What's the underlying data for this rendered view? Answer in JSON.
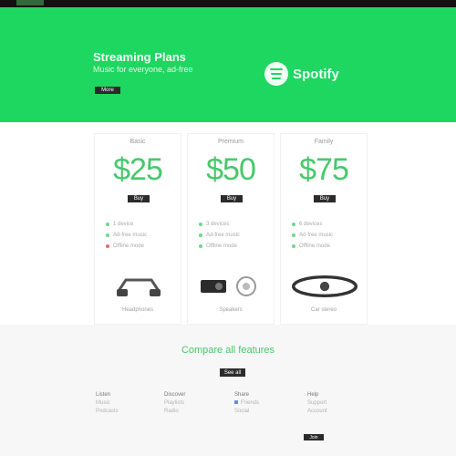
{
  "hero": {
    "title": "Streaming Plans",
    "subtitle": "Music for everyone, ad-free",
    "cta_label": "More",
    "brand_name": "Spotify"
  },
  "plans": [
    {
      "name": "Basic",
      "price": "$25",
      "button_label": "Buy",
      "features": [
        {
          "text": "1 device",
          "status": "included"
        },
        {
          "text": "Ad-free music",
          "status": "included"
        },
        {
          "text": "Offline mode",
          "status": "excluded"
        }
      ],
      "device_label": "Headphones",
      "device_icon": "headphones-icon"
    },
    {
      "name": "Premium",
      "price": "$50",
      "button_label": "Buy",
      "features": [
        {
          "text": "3 devices",
          "status": "included"
        },
        {
          "text": "Ad-free music",
          "status": "included"
        },
        {
          "text": "Offline mode",
          "status": "included"
        }
      ],
      "device_label": "Speakers",
      "device_icon": "speaker-icon"
    },
    {
      "name": "Family",
      "price": "$75",
      "button_label": "Buy",
      "features": [
        {
          "text": "6 devices",
          "status": "included"
        },
        {
          "text": "Ad-free music",
          "status": "included"
        },
        {
          "text": "Offline mode",
          "status": "included"
        }
      ],
      "device_label": "Car stereo",
      "device_icon": "car-icon"
    }
  ],
  "lower": {
    "title": "Compare all features",
    "button_label": "See all",
    "columns": [
      {
        "heading": "Listen",
        "lines": [
          "Music",
          "Podcasts"
        ]
      },
      {
        "heading": "Discover",
        "lines": [
          "Playlists",
          "Radio"
        ]
      },
      {
        "heading": "Share",
        "lines": [
          "Friends",
          "Social"
        ]
      },
      {
        "heading": "Help",
        "lines": [
          "Support",
          "Account"
        ]
      }
    ],
    "footer_button_label": "Join"
  },
  "colors": {
    "brand_green": "#1ed760",
    "price_green": "#47c96b",
    "dark": "#2b2b2b"
  }
}
